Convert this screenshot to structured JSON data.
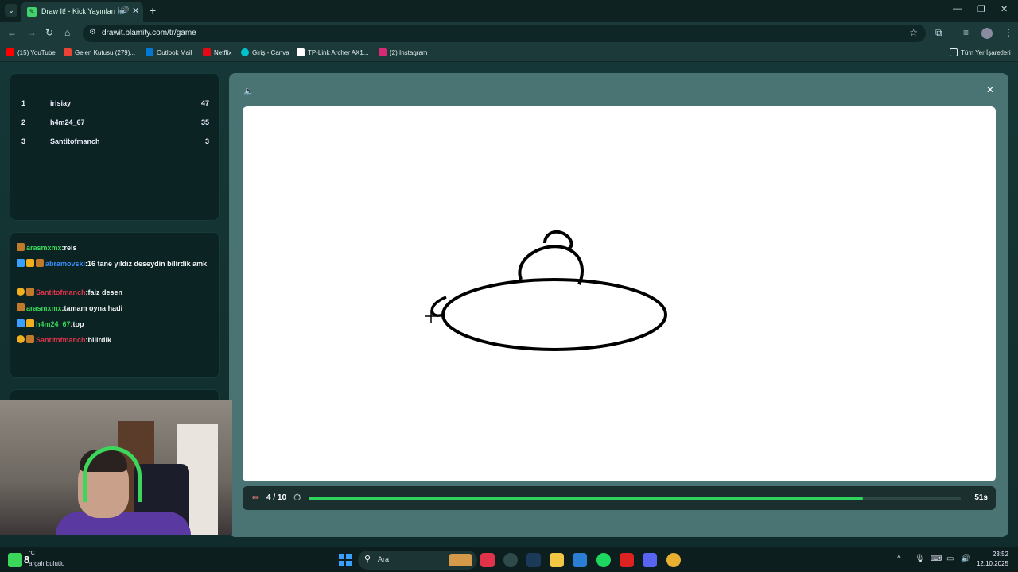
{
  "browser": {
    "tab_title": "Draw It! - Kick Yayınları İçin",
    "url": "drawit.blamity.com/tr/game",
    "bookmarks": [
      {
        "label": "(15) YouTube",
        "color": "#ff0000"
      },
      {
        "label": "Gelen Kutusu (279)...",
        "color": "#ea4335"
      },
      {
        "label": "Outlook Mail",
        "color": "#0078d4"
      },
      {
        "label": "Netflix",
        "color": "#e50914"
      },
      {
        "label": "Giriş - Canva",
        "color": "#00c4cc"
      },
      {
        "label": "TP-Link Archer AX1...",
        "color": "#ffffff"
      },
      {
        "label": "(2) Instagram",
        "color": "#d62976"
      }
    ],
    "all_bookmarks": "Tüm Yer İşaretleri"
  },
  "leaderboard": [
    {
      "rank": "1",
      "name": "irisiay",
      "score": "47"
    },
    {
      "rank": "2",
      "name": "h4m24_67",
      "score": "35"
    },
    {
      "rank": "3",
      "name": "Santitofmanch",
      "score": "3"
    }
  ],
  "chat": [
    {
      "user": "arasmxmx",
      "user_color": "#3cd65a",
      "message": ":reis"
    },
    {
      "user": "abramovski",
      "user_color": "#3a8dff",
      "message": ":16 tane yıldız deseydin bilirdik amk"
    },
    {
      "user": "Santitofmanch",
      "user_color": "#e0334a",
      "message": ":faiz desen"
    },
    {
      "user": "arasmxmx",
      "user_color": "#3cd65a",
      "message": ":tamam oyna hadi"
    },
    {
      "user": "h4m24_67",
      "user_color": "#3cd65a",
      "message": ":top"
    },
    {
      "user": "Santitofmanch",
      "user_color": "#e0334a",
      "message": ":bilirdik"
    }
  ],
  "game": {
    "round": "4 / 10",
    "progress": 0.85,
    "time_left": "51s",
    "accent": "#2fd45c"
  },
  "taskbar": {
    "weather_count": "8",
    "weather_temp": "°C",
    "weather_desc": "arçalı bulutlu",
    "search_placeholder": "Ara",
    "time": "23:52",
    "date": "12.10.2025"
  }
}
